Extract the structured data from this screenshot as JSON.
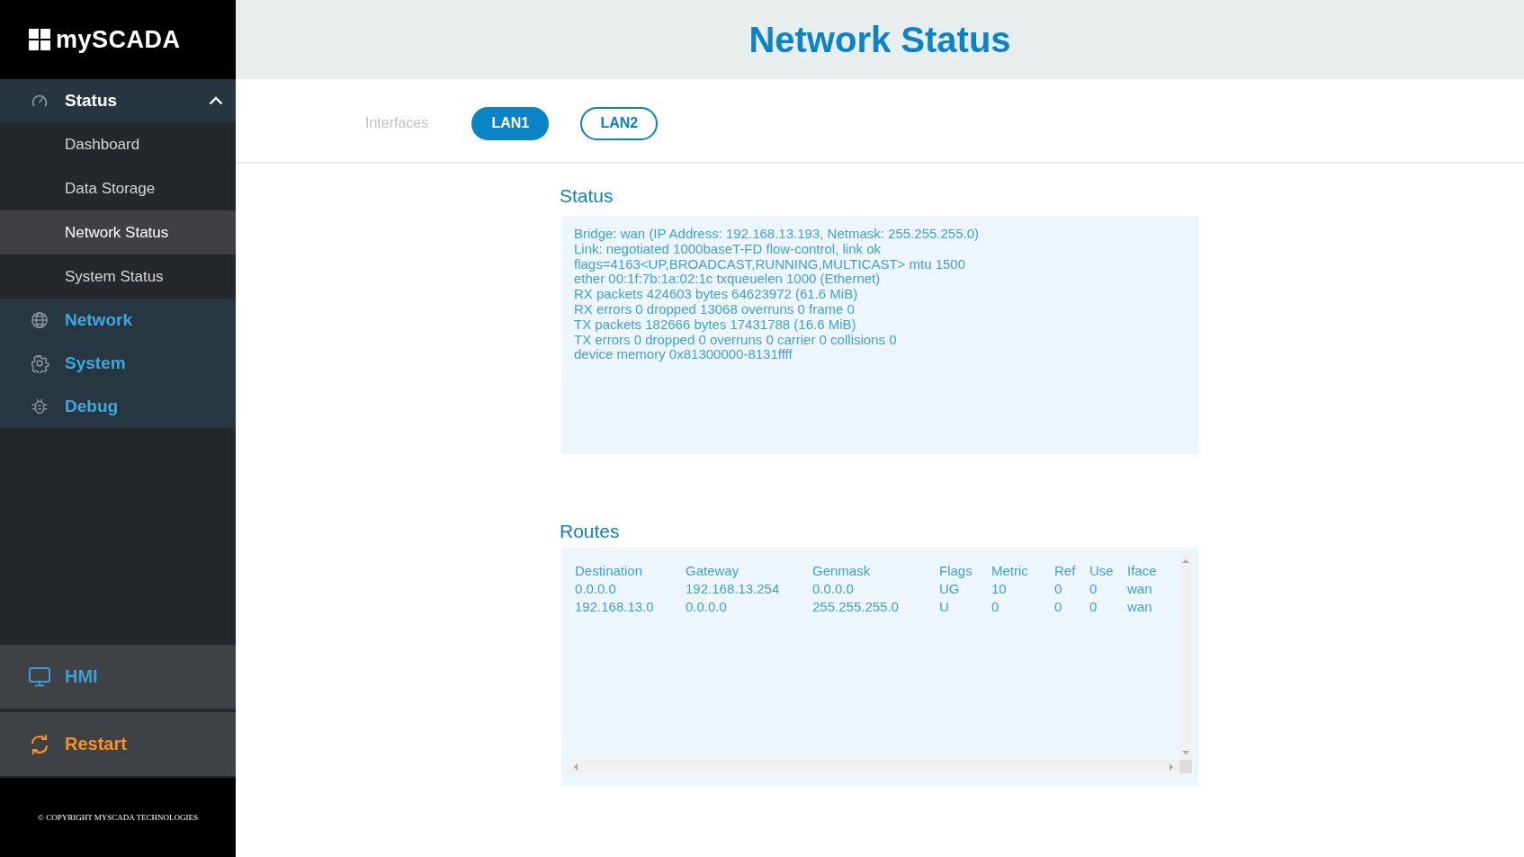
{
  "sidebar": {
    "logo": "mySCADA",
    "groups": [
      {
        "label": "Status",
        "expanded": true,
        "children": [
          {
            "label": "Dashboard",
            "selected": false
          },
          {
            "label": "Data Storage",
            "selected": false
          },
          {
            "label": "Network Status",
            "selected": true
          },
          {
            "label": "System Status",
            "selected": false
          }
        ]
      },
      {
        "label": "Network",
        "expanded": false
      },
      {
        "label": "System",
        "expanded": false
      },
      {
        "label": "Debug",
        "expanded": false
      }
    ],
    "bottom": [
      {
        "label": "HMI",
        "kind": "hmi"
      },
      {
        "label": "Restart",
        "kind": "restart"
      }
    ],
    "copyright": "© COPYRIGHT MYSCADA TECHNOLOGIES"
  },
  "page": {
    "title": "Network Status"
  },
  "interfaces": {
    "label": "Interfaces",
    "tabs": [
      {
        "label": "LAN1",
        "selected": true
      },
      {
        "label": "LAN2",
        "selected": false
      }
    ]
  },
  "status": {
    "heading": "Status",
    "lines": [
      "Bridge: wan (IP Address: 192.168.13.193, Netmask: 255.255.255.0)",
      "Link: negotiated 1000baseT-FD flow-control, link ok",
      "flags=4163<UP,BROADCAST,RUNNING,MULTICAST> mtu 1500",
      "ether 00:1f:7b:1a:02:1c txqueuelen 1000 (Ethernet)",
      "RX packets 424603 bytes 64623972 (61.6 MiB)",
      "RX errors 0 dropped 13068 overruns 0 frame 0",
      "TX packets 182666 bytes 17431788 (16.6 MiB)",
      "TX errors 0 dropped 0 overruns 0 carrier 0 collisions 0",
      "device memory 0x81300000-8131ffff"
    ]
  },
  "routes": {
    "heading": "Routes",
    "columns": [
      "Destination",
      "Gateway",
      "Genmask",
      "Flags",
      "Metric",
      "Ref",
      "Use",
      "Iface"
    ],
    "rows": [
      [
        "0.0.0.0",
        "192.168.13.254",
        "0.0.0.0",
        "UG",
        "10",
        "0",
        "0",
        "wan"
      ],
      [
        "192.168.13.0",
        "0.0.0.0",
        "255.255.255.0",
        "U",
        "0",
        "0",
        "0",
        "wan"
      ]
    ]
  }
}
